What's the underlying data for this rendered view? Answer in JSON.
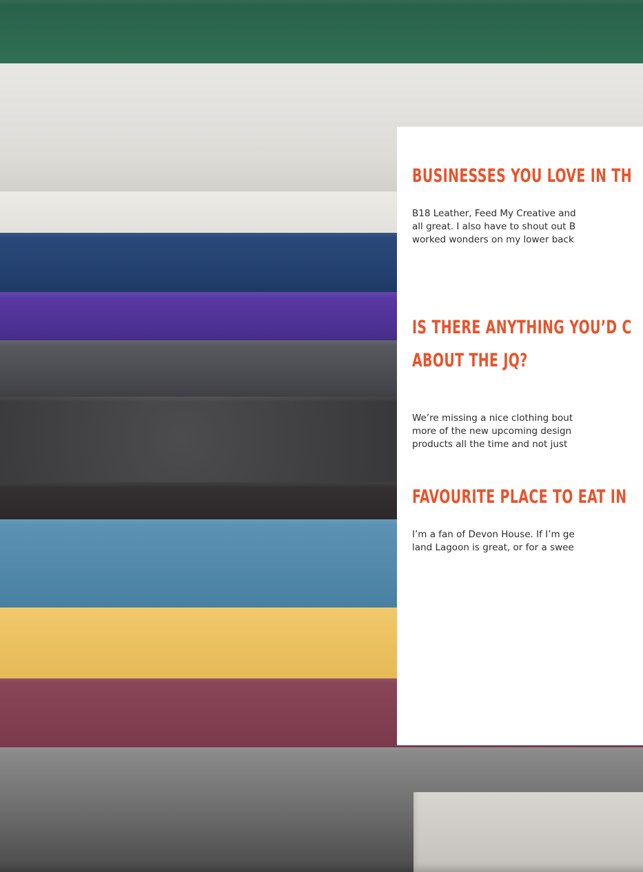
{
  "photo": {
    "description_icon": "folded-fabric-stack-photo",
    "colors": [
      "#2f6b4f",
      "#d9d8d4",
      "#e6e5e1",
      "#203a66",
      "#4a2f8f",
      "#4a4b50",
      "#3a3a3c",
      "#2c2a2a",
      "#4f87a8",
      "#e7be5e",
      "#7d3a4c",
      "#5a5a5a"
    ]
  },
  "sections": [
    {
      "heading": "BUSINESSES YOU LOVE IN TH",
      "lines": [
        "B18 Leather, Feed My Creative and",
        "all great. I also have to shout out B",
        "worked wonders on my lower back"
      ]
    },
    {
      "heading_lines": [
        "IS THERE ANYTHING YOU’D C",
        "ABOUT THE JQ?"
      ],
      "lines": [
        "We’re missing a nice clothing bout",
        "more of the new upcoming design",
        "products all the time and not just"
      ]
    },
    {
      "heading": "FAVOURITE PLACE TO EAT IN",
      "lines": [
        "I’m a fan of Devon House. If I’m ge",
        "land Lagoon is great, or for a swee"
      ]
    }
  ],
  "accent_color": "#e8532b"
}
